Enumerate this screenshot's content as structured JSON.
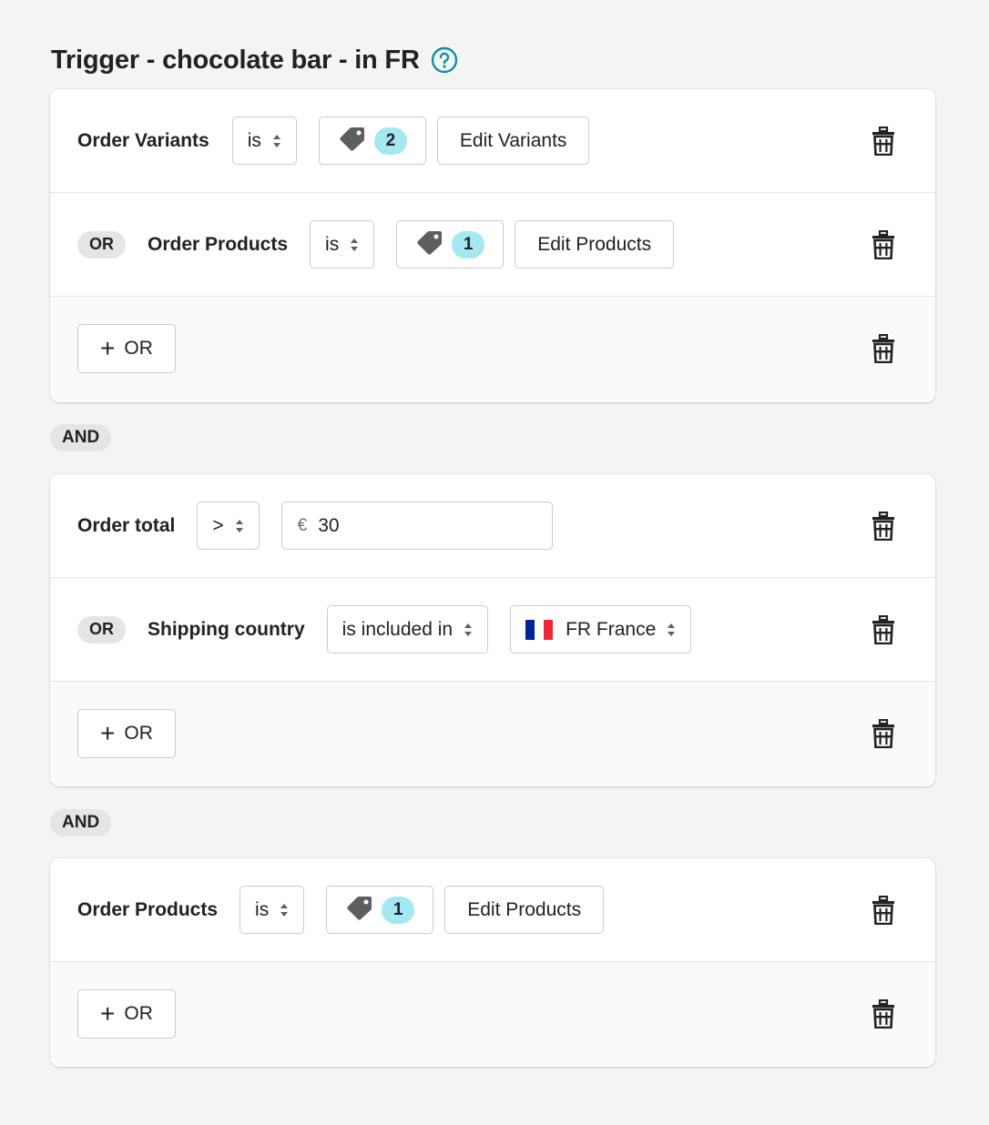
{
  "page": {
    "title": "Trigger - chocolate bar - in FR",
    "help_icon": "question-circle-icon",
    "accent_color": "#0f8fa3"
  },
  "groups": [
    {
      "conditions": [
        {
          "or_label": "",
          "field": "Order Variants",
          "operator": "is",
          "tag_icon": "tag-icon",
          "count": "2",
          "edit_label": "Edit Variants"
        },
        {
          "or_label": "OR",
          "field": "Order Products",
          "operator": "is",
          "tag_icon": "tag-icon",
          "count": "1",
          "edit_label": "Edit Products"
        }
      ],
      "add_or_label": "OR"
    },
    {
      "conditions": [
        {
          "field": "Order total",
          "operator": ">",
          "currency_symbol": "€",
          "value": "30"
        },
        {
          "or_label": "OR",
          "field": "Shipping country",
          "operator": "is included in",
          "country": "FR France",
          "flag_colors": [
            "#002395",
            "#ffffff",
            "#ed2939"
          ]
        }
      ],
      "add_or_label": "OR"
    },
    {
      "conditions": [
        {
          "field": "Order Products",
          "operator": "is",
          "tag_icon": "tag-icon",
          "count": "1",
          "edit_label": "Edit Products"
        }
      ],
      "add_or_label": "OR"
    }
  ],
  "connectors": [
    "AND",
    "AND"
  ],
  "icons": {
    "delete": "trash-icon",
    "sort": "select-arrows-icon",
    "add": "plus-icon"
  }
}
